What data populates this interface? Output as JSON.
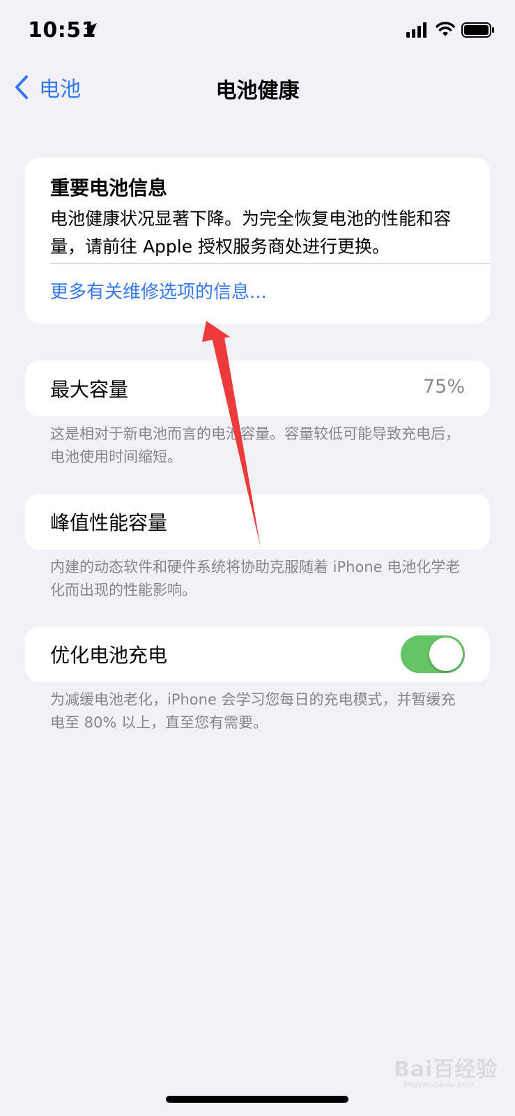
{
  "status_bar": {
    "time": "10:51",
    "icons": [
      "location-arrow-icon",
      "cellular-signal-icon",
      "wifi-icon",
      "battery-icon"
    ]
  },
  "nav": {
    "back_label": "电池",
    "title": "电池健康"
  },
  "important_info": {
    "title": "重要电池信息",
    "body": "电池健康状况显著下降。为完全恢复电池的性能和容量，请前往 Apple 授权服务商处进行更换。",
    "link": "更多有关维修选项的信息..."
  },
  "max_capacity": {
    "label": "最大容量",
    "value": "75%",
    "footnote": "这是相对于新电池而言的电池容量。容量较低可能导致充电后，电池使用时间缩短。"
  },
  "peak_performance": {
    "label": "峰值性能容量",
    "footnote": "内建的动态软件和硬件系统将协助克服随着 iPhone 电池化学老化而出现的性能影响。"
  },
  "optimized_charging": {
    "label": "优化电池充电",
    "enabled": true,
    "footnote": "为减缓电池老化，iPhone 会学习您每日的充电模式，并暂缓充电至 80% 以上，直至您有需要。"
  },
  "watermark": {
    "text": "Bai百经验",
    "sub": "jingyan.baidu.com"
  },
  "colors": {
    "accent": "#3478f6",
    "toggle_on": "#64c466",
    "background": "#f1f1f6",
    "annotation_arrow": "#ee3a3a"
  }
}
